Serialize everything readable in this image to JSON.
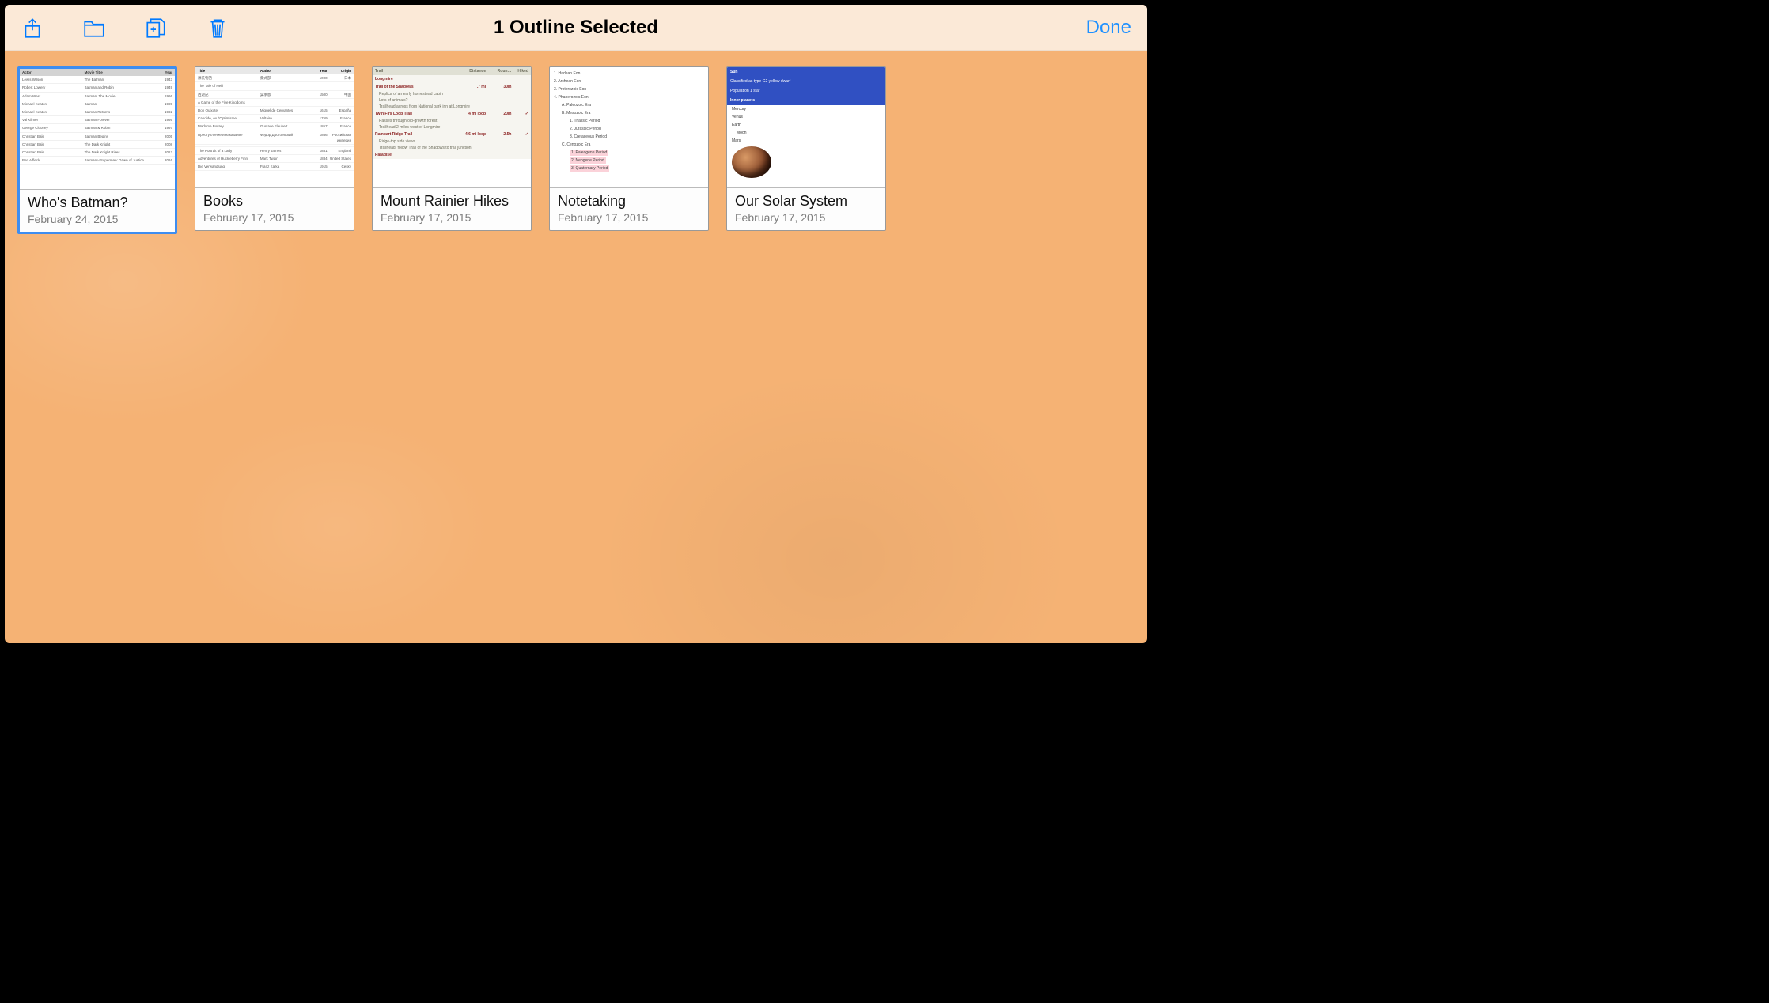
{
  "toolbar": {
    "title": "1 Outline Selected",
    "done_label": "Done"
  },
  "colors": {
    "accent": "#007aff",
    "selection": "#3e8df0",
    "background": "#f5b274",
    "toolbar_bg": "#fbe9d7"
  },
  "documents": [
    {
      "title": "Who's Batman?",
      "date": "February 24, 2015",
      "selected": true,
      "thumb": "batman"
    },
    {
      "title": "Books",
      "date": "February 17, 2015",
      "selected": false,
      "thumb": "books"
    },
    {
      "title": "Mount Rainier Hikes",
      "date": "February 17, 2015",
      "selected": false,
      "thumb": "hikes"
    },
    {
      "title": "Notetaking",
      "date": "February 17, 2015",
      "selected": false,
      "thumb": "notes"
    },
    {
      "title": "Our Solar System",
      "date": "February 17, 2015",
      "selected": false,
      "thumb": "solar"
    }
  ],
  "thumbs": {
    "batman": {
      "columns": [
        "Actor",
        "Movie Title",
        "Year"
      ],
      "rows": [
        [
          "Lewis Wilson",
          "The Batman",
          "1943"
        ],
        [
          "Robert Lowery",
          "Batman and Robin",
          "1949"
        ],
        [
          "Adam West",
          "Batman: The Movie",
          "1966"
        ],
        [
          "Michael Keaton",
          "Batman",
          "1989"
        ],
        [
          "Michael Keaton",
          "Batman Returns",
          "1992"
        ],
        [
          "Val Kilmer",
          "Batman Forever",
          "1995"
        ],
        [
          "George Clooney",
          "Batman & Robin",
          "1997"
        ],
        [
          "Christian Bale",
          "Batman Begins",
          "2005"
        ],
        [
          "Christian Bale",
          "The Dark Knight",
          "2008"
        ],
        [
          "Christian Bale",
          "The Dark Knight Rises",
          "2012"
        ],
        [
          "Ben Affleck",
          "Batman v Superman: Dawn of Justice",
          "2016"
        ]
      ]
    },
    "books": {
      "columns": [
        "Title",
        "Author",
        "Year",
        "Origin"
      ],
      "rows": [
        [
          "源氏物語",
          "紫式部",
          "1000",
          "日本"
        ],
        [
          "The Tale of Heiji",
          "",
          "",
          ""
        ],
        [
          "西遊記",
          "吳承恩",
          "1500",
          "中国"
        ],
        [
          "A Game of the Five Kingdoms",
          "",
          "",
          ""
        ],
        [
          "Don Quixote",
          "Miguel de Cervantes",
          "1615",
          "España"
        ],
        [
          "Candide, ou l'Optimisme",
          "Voltaire",
          "1759",
          "France"
        ],
        [
          "Madame Bovary",
          "Gustave Flaubert",
          "1857",
          "France"
        ],
        [
          "Преступление и наказание",
          "Фёдор Достоевский",
          "1866",
          "Российская империя"
        ],
        [
          "",
          "",
          "",
          ""
        ],
        [
          "The Portrait of a Lady",
          "Henry James",
          "1881",
          "England"
        ],
        [
          "Adventures of Huckleberry Finn",
          "Mark Twain",
          "1884",
          "United States"
        ],
        [
          "Die Verwandlung",
          "Franz Kafka",
          "1915",
          "Česky"
        ]
      ]
    },
    "hikes": {
      "columns": [
        "Trail",
        "Distance",
        "Roun…",
        "Hiked"
      ],
      "sections": [
        {
          "name": "Longmire",
          "trails": [
            {
              "name": "Trail of the Shadows",
              "dist": ".7 mi",
              "time": "30m",
              "hiked": false,
              "notes": [
                "Replica of an early homestead cabin",
                "Lots of animals?",
                "Trailhead across from National park inn at Longmire"
              ]
            },
            {
              "name": "Twin Firs Loop Trail",
              "dist": ".4 mi loop",
              "time": "20m",
              "hiked": true,
              "notes": [
                "Passes through old-growth forest",
                "Trailhead 2 miles west of Longmire"
              ]
            },
            {
              "name": "Rampart Ridge Trail",
              "dist": "4.6 mi loop",
              "time": "2.5h",
              "hiked": true,
              "notes": [
                "Ridge-top side views",
                "Trailhead: follow Trail of the Shadows to trail junction"
              ]
            }
          ]
        },
        {
          "name": "Paradise",
          "trails": []
        }
      ]
    },
    "notes": {
      "outline": [
        {
          "n": "1",
          "t": "Hadean Eon"
        },
        {
          "n": "2",
          "t": "Archean Eon"
        },
        {
          "n": "3",
          "t": "Proterozoic Eon"
        },
        {
          "n": "4",
          "t": "Phanerozoic Eon",
          "children": [
            {
              "n": "A",
              "t": "Paleozoic Era"
            },
            {
              "n": "B",
              "t": "Mesozoic Era",
              "children": [
                {
                  "n": "1",
                  "t": "Triassic Period"
                },
                {
                  "n": "2",
                  "t": "Jurassic Period"
                },
                {
                  "n": "3",
                  "t": "Cretaceous Period"
                }
              ]
            },
            {
              "n": "C",
              "t": "Cenozoic Era",
              "children": [
                {
                  "n": "1",
                  "t": "Paleogene Period",
                  "hl": true
                },
                {
                  "n": "2",
                  "t": "Neogene Period",
                  "hl": true
                },
                {
                  "n": "3",
                  "t": "Quaternary Period",
                  "hl": true
                }
              ]
            }
          ]
        }
      ]
    },
    "solar": {
      "rows": [
        {
          "type": "h1",
          "t": "Sun"
        },
        {
          "type": "sub",
          "t": "Classified as type G2 yellow dwarf"
        },
        {
          "type": "sub",
          "t": "Population 1 star"
        },
        {
          "type": "h1",
          "t": "Inner planets"
        },
        {
          "type": "item",
          "t": "Mercury"
        },
        {
          "type": "item",
          "t": "Venus"
        },
        {
          "type": "item",
          "t": "Earth"
        },
        {
          "type": "sub2",
          "t": "Moon"
        },
        {
          "type": "item",
          "t": "Mars"
        },
        {
          "type": "img"
        }
      ]
    }
  }
}
